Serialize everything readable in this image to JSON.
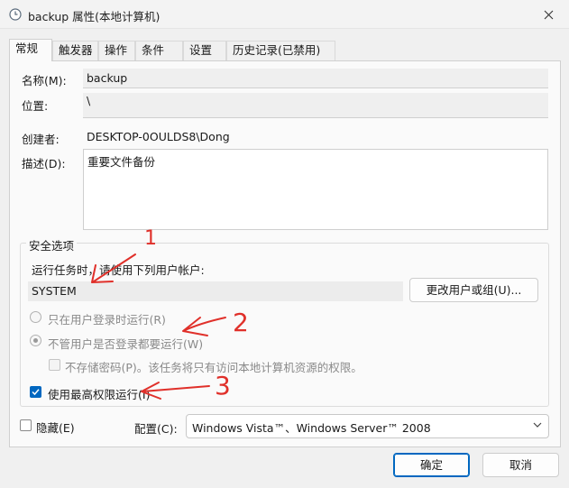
{
  "window": {
    "title": "backup 属性(本地计算机)"
  },
  "tabs": [
    {
      "label": "常规",
      "active": true
    },
    {
      "label": "触发器"
    },
    {
      "label": "操作"
    },
    {
      "label": "条件"
    },
    {
      "label": "设置"
    },
    {
      "label": "历史记录(已禁用)"
    }
  ],
  "general": {
    "name_label": "名称(M):",
    "name_value": "backup",
    "location_label": "位置:",
    "location_value": "\\",
    "author_label": "创建者:",
    "author_value": "DESKTOP-0OULDS8\\Dong",
    "description_label": "描述(D):",
    "description_value": "重要文件备份"
  },
  "security": {
    "group_title": "安全选项",
    "run_as_prompt": "运行任务时，请使用下列用户帐户:",
    "user_account": "SYSTEM",
    "change_user_button": "更改用户或组(U)...",
    "radio_logged_on": "只在用户登录时运行(R)",
    "radio_whether_logged_on": "不管用户是否登录都要运行(W)",
    "no_store_password": "不存储密码(P)。该任务将只有访问本地计算机资源的权限。",
    "highest_privileges": "使用最高权限运行(I)"
  },
  "footer": {
    "hidden_label": "隐藏(E)",
    "configure_label": "配置(C):",
    "configure_value": "Windows Vista™、Windows Server™ 2008",
    "ok_button": "确定",
    "cancel_button": "取消"
  },
  "annotations": {
    "mark1": "1",
    "mark2": "2",
    "mark3": "3"
  },
  "colors": {
    "accent": "#0067c0",
    "annotation": "#e0302a"
  }
}
